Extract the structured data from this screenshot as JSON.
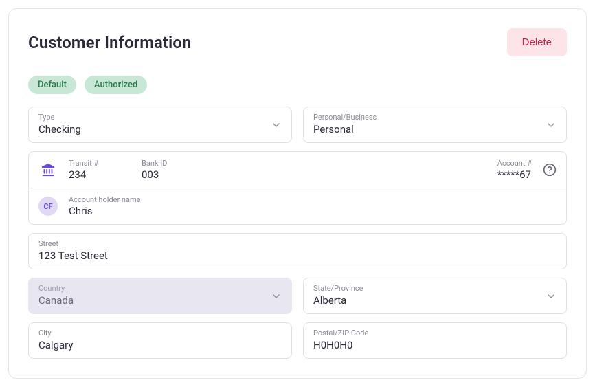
{
  "header": {
    "title": "Customer Information",
    "delete_label": "Delete"
  },
  "badges": {
    "default": "Default",
    "authorized": "Authorized"
  },
  "fields": {
    "type": {
      "label": "Type",
      "value": "Checking"
    },
    "personal_business": {
      "label": "Personal/Business",
      "value": "Personal"
    },
    "transit": {
      "label": "Transit #",
      "value": "234"
    },
    "bank_id": {
      "label": "Bank ID",
      "value": "003"
    },
    "account": {
      "label": "Account #",
      "value": "*****67"
    },
    "holder": {
      "label": "Account holder name",
      "value": "Chris",
      "initials": "CF"
    },
    "street": {
      "label": "Street",
      "value": "123 Test Street"
    },
    "country": {
      "label": "Country",
      "value": "Canada"
    },
    "state": {
      "label": "State/Province",
      "value": "Alberta"
    },
    "city": {
      "label": "City",
      "value": "Calgary"
    },
    "postal": {
      "label": "Postal/ZIP Code",
      "value": "H0H0H0"
    }
  }
}
